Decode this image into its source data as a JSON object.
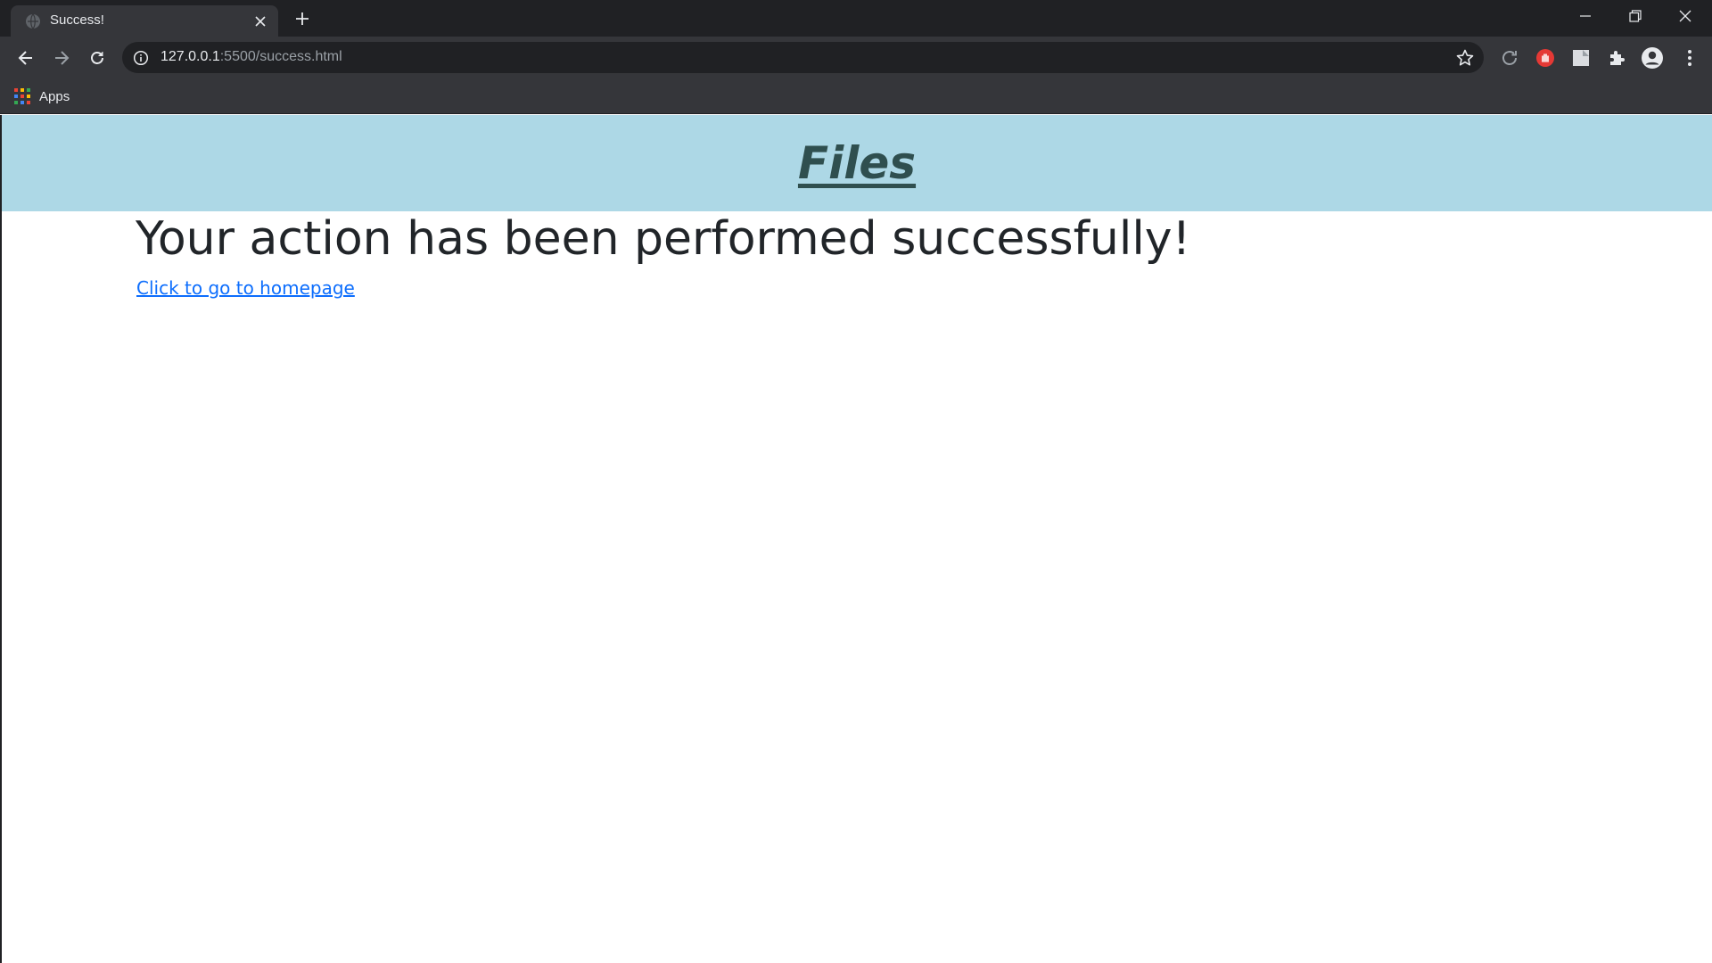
{
  "browser": {
    "tab": {
      "title": "Success!",
      "favicon": "globe-icon"
    },
    "address_bar": {
      "host": "127.0.0.1",
      "rest": ":5500/success.html"
    },
    "bookmarks": {
      "apps_label": "Apps"
    },
    "colors": {
      "tabstrip": "#202124",
      "toolbar": "#35363a",
      "extension_red": "#e53935"
    }
  },
  "page": {
    "header": {
      "title": "Files",
      "background": "#add8e6",
      "title_color": "#2f4f4f"
    },
    "message": "Your action has been performed successfully!",
    "link_text": "Click to go to homepage"
  }
}
